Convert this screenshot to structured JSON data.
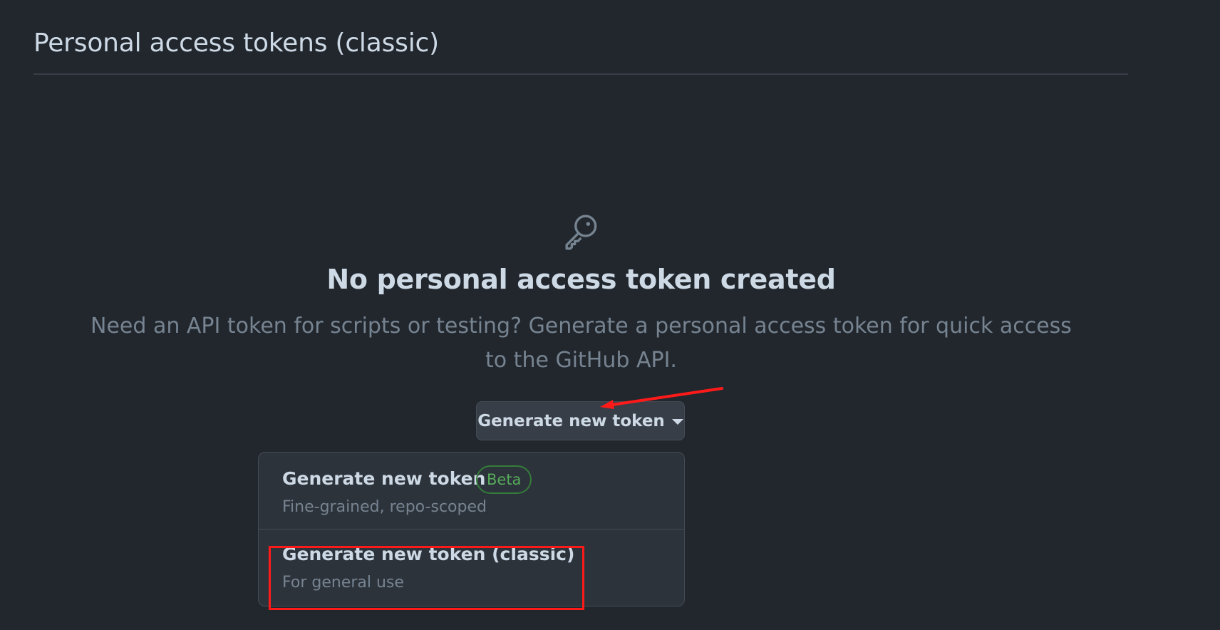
{
  "header": {
    "title": "Personal access tokens (classic)"
  },
  "blankslate": {
    "icon": "key-icon",
    "title": "No personal access token created",
    "description": "Need an API token for scripts or testing? Generate a personal access token for quick access to the GitHub API."
  },
  "generate_button": {
    "label": "Generate new token",
    "icon": "triangle-down-icon"
  },
  "dropdown": {
    "items": [
      {
        "label": "Generate new token",
        "badge": "Beta",
        "description": "Fine-grained, repo-scoped"
      },
      {
        "label": "Generate new token (classic)",
        "description": "For general use"
      }
    ]
  },
  "colors": {
    "background": "#22272e",
    "annotation": "#ff1a1a",
    "badge_green": "#57ab5a"
  }
}
